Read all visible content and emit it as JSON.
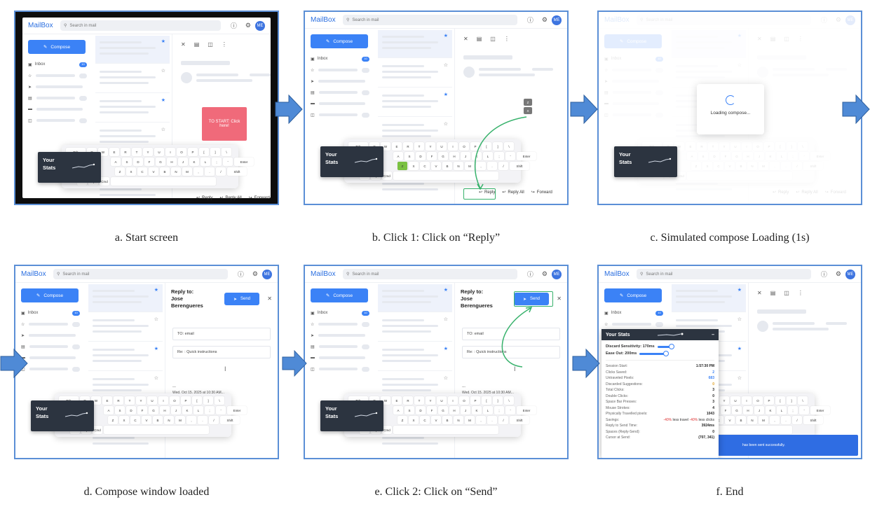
{
  "app": {
    "logo": "MailBox",
    "search_placeholder": "Search in mail",
    "avatar": "ME",
    "compose": "Compose",
    "inbox": "Inbox",
    "inbox_count": "10"
  },
  "reader": {
    "reply": "Reply",
    "reply_all": "Reply All",
    "forward": "Forward",
    "start_overlay": "TO START: Click here!"
  },
  "stats_widget": {
    "title_1": "Your",
    "title_2": "Stats"
  },
  "keyboard": {
    "row1": [
      "Tab",
      "Q",
      "W",
      "E",
      "R",
      "T",
      "Y",
      "U",
      "I",
      "O",
      "P",
      "[",
      "]",
      "\\"
    ],
    "row2": [
      "A",
      "S",
      "D",
      "F",
      "G",
      "H",
      "J",
      "K",
      "L",
      ";",
      "'",
      "Enter"
    ],
    "row3": [
      "Z",
      "X",
      "C",
      "V",
      "B",
      "N",
      "M",
      ",",
      ".",
      "/",
      "Shift"
    ],
    "row4": [
      "Ctrl",
      "Opt",
      "Cmd"
    ],
    "zx_keys": [
      "Z",
      "X"
    ]
  },
  "loading": {
    "text": "Loading compose..."
  },
  "compose_window": {
    "reply_to_label": "Reply to:",
    "reply_to_name_1": "Jose",
    "reply_to_name_2": "Berengueres",
    "send": "Send",
    "to_field": "TO: email",
    "subject_field": "Re: : Quick instructions",
    "dashes": "---",
    "quote_line": "Wed, Oct 15, 2025 at 10:30 AM..."
  },
  "stats_panel": {
    "title": "Your Stats",
    "discard_label": "Discard Sensitivity: 170ms",
    "easeout_label": "Ease Out: 200ms",
    "rows": [
      {
        "label": "Session Start:",
        "value": "1:57:30 PM"
      },
      {
        "label": "Clicks Saved:",
        "value": "2"
      },
      {
        "label": "Untraveled Pixels:",
        "value": "683"
      },
      {
        "label": "Discarded Suggestions:",
        "value": "0"
      },
      {
        "label": "Total Clicks:",
        "value": "3"
      },
      {
        "label": "Double Clicks:",
        "value": "0"
      },
      {
        "label": "Space Bar Presses:",
        "value": "3"
      },
      {
        "label": "Mouse Strokes:",
        "value": "4"
      },
      {
        "label": "Physically Travelled pixels:",
        "value": "1043"
      },
      {
        "label": "Reply to Send Time:",
        "value": "3924ms"
      },
      {
        "label": "Spaces (Reply-Send):",
        "value": "0"
      },
      {
        "label": "Cursor at Send:",
        "value": "(707, 341)"
      }
    ],
    "savings_label": "Savings:",
    "savings_a": "-40%",
    "savings_b": " less travel ",
    "savings_c": "-40%",
    "savings_d": " less clicks",
    "toast": "has been sent successfully."
  },
  "captions": {
    "a": "a. Start screen",
    "b": "b. Click 1: Click on “Reply”",
    "c": "c. Simulated compose Loading (1s)",
    "d": "d. Compose window loaded",
    "e": "e. Click 2: Click on “Send”",
    "f": "f. End"
  },
  "colors": {
    "accent": "#3b82f6",
    "stats_dark": "#2c3440",
    "highlight": "#38b26c",
    "overlay_pink": "#f06a7a",
    "arrow": "#4f8ad6"
  }
}
